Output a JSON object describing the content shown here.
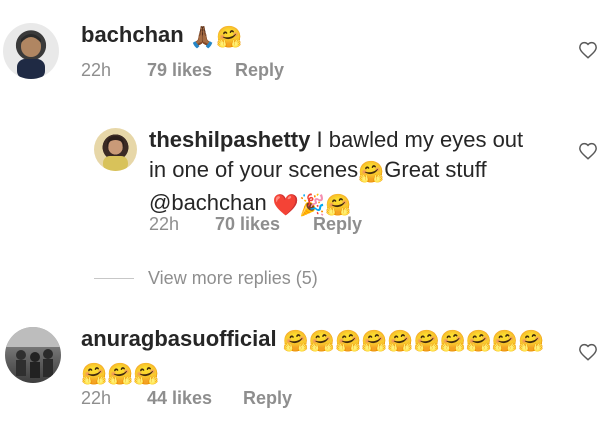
{
  "comments": [
    {
      "username": "bachchan",
      "text_emojis": "🙏🏾🤗",
      "time": "22h",
      "likes": "79 likes",
      "reply": "Reply"
    },
    {
      "username": "theshilpashetty",
      "text_line1": " I bawled my eyes out",
      "text_line2a": "in one of your scenes",
      "emoji_a": "🤗",
      "text_line2b": "Great stuff",
      "mention": "@bachchan",
      "emojis_end": "❤️🎉🤗",
      "time": "22h",
      "likes": "70 likes",
      "reply": "Reply"
    },
    {
      "username": "anuragbasuofficial",
      "emojis_line1": "🤗🤗🤗🤗🤗🤗🤗🤗🤗🤗",
      "emojis_line2": "🤗🤗🤗",
      "time": "22h",
      "likes": "44 likes",
      "reply": "Reply"
    }
  ],
  "view_more": "View more replies (5)",
  "icons": {
    "heart": "heart-outline-icon"
  },
  "colors": {
    "text": "#262626",
    "muted": "#8e8e8e"
  }
}
